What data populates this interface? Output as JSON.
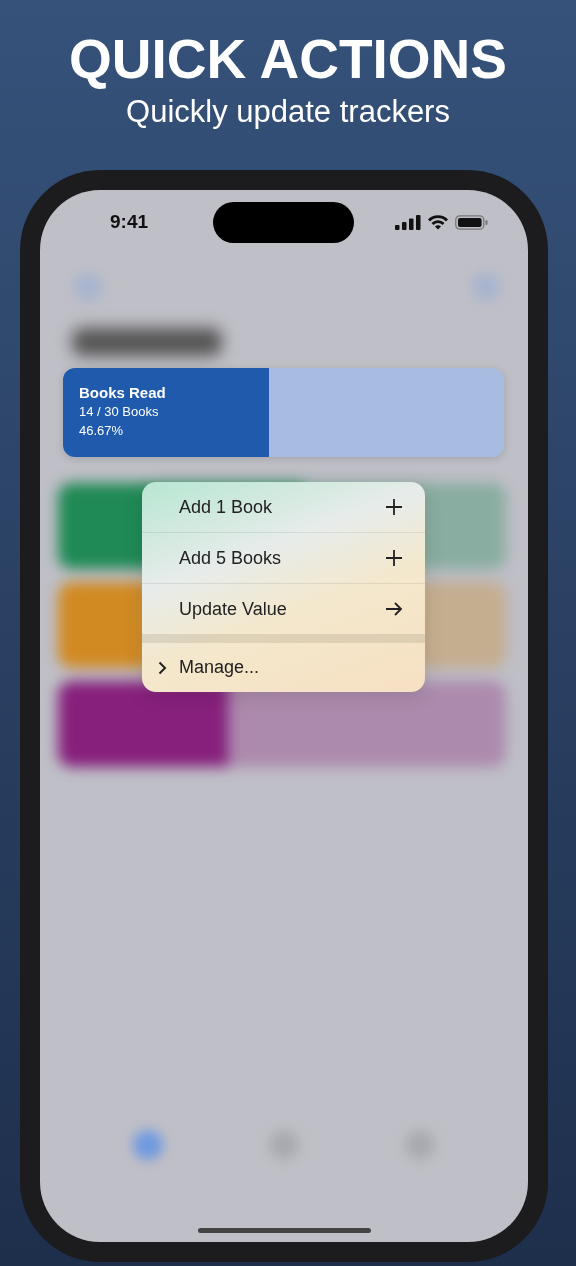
{
  "header": {
    "title": "QUICK ACTIONS",
    "subtitle": "Quickly update trackers"
  },
  "status_bar": {
    "time": "9:41"
  },
  "tracker": {
    "name": "Books Read",
    "progress": "14 / 30 Books",
    "percent": "46.67%",
    "level": 0.4667
  },
  "background_cards": [
    {
      "color": "#1f8a55",
      "level": 0.55
    },
    {
      "color": "#d18a22",
      "level": 0.2
    },
    {
      "color": "#86207c",
      "level": 0.38
    }
  ],
  "menu": {
    "items": [
      {
        "label": "Add 1 Book",
        "kind": "add"
      },
      {
        "label": "Add 5 Books",
        "kind": "add"
      },
      {
        "label": "Update Value",
        "kind": "open"
      },
      {
        "label": "Manage...",
        "kind": "submenu"
      }
    ]
  },
  "tab_bar": {
    "items": [
      {
        "selected": true
      },
      {
        "selected": false
      },
      {
        "selected": false
      }
    ]
  }
}
